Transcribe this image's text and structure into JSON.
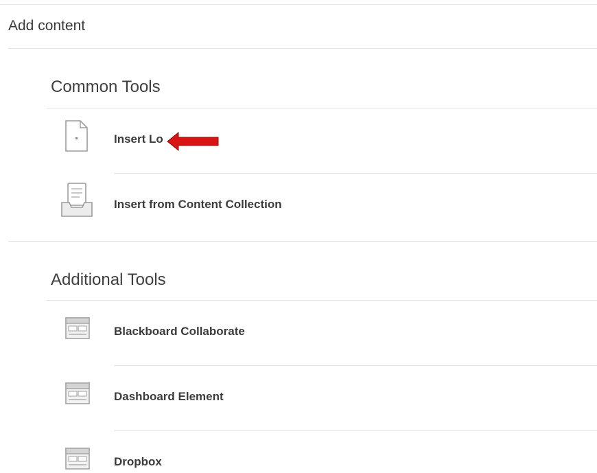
{
  "panel": {
    "title": "Add content"
  },
  "common_tools": {
    "heading": "Common Tools",
    "items": [
      {
        "label": "Insert Lo",
        "icon": "document-file-icon"
      },
      {
        "label": "Insert from Content Collection",
        "icon": "content-collection-tray-icon"
      }
    ]
  },
  "additional_tools": {
    "heading": "Additional Tools",
    "items": [
      {
        "label": "Blackboard Collaborate",
        "icon": "tool-window-icon"
      },
      {
        "label": "Dashboard Element",
        "icon": "tool-window-icon"
      },
      {
        "label": "Dropbox",
        "icon": "tool-window-icon"
      }
    ]
  },
  "annotation": {
    "arrow_icon": "red-arrow-left-icon",
    "arrow_color": "#d91414"
  }
}
